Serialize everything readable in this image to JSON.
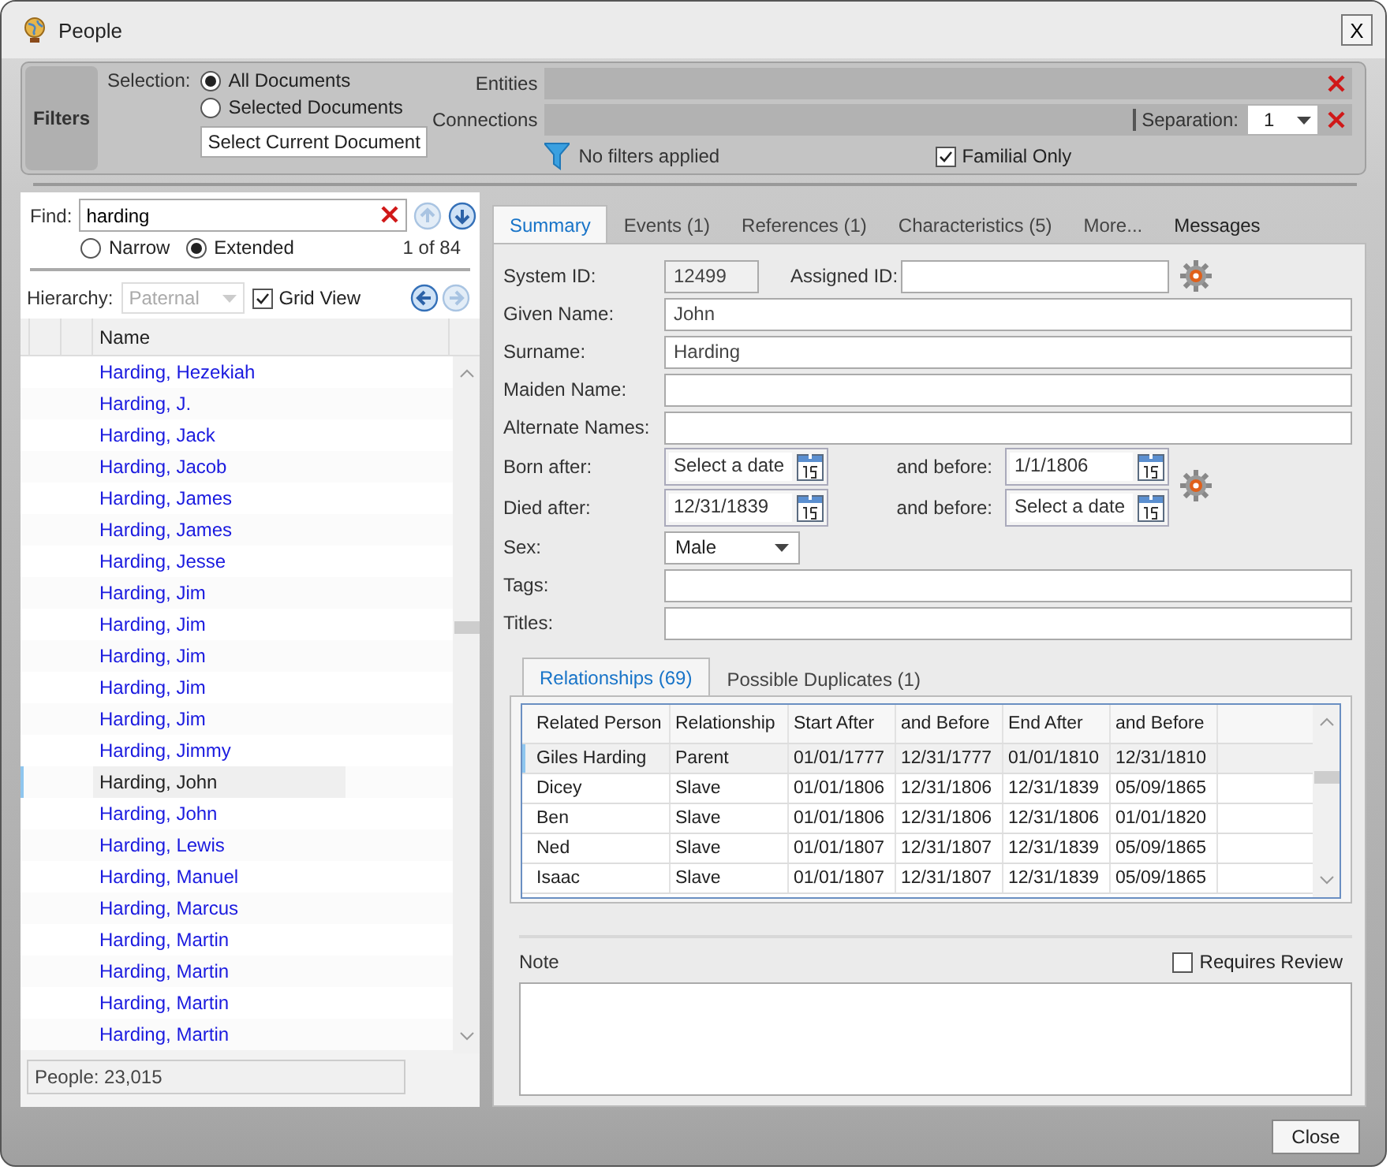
{
  "window": {
    "title": "People",
    "close": "X"
  },
  "filters": {
    "label": "Filters",
    "selection_label": "Selection:",
    "options": [
      {
        "label": "All Documents",
        "selected": true
      },
      {
        "label": "Selected Documents",
        "selected": false
      }
    ],
    "select_current_button": "Select Current Document",
    "entities_label": "Entities",
    "connections_label": "Connections",
    "separation_label": "Separation:",
    "separation_value": "1",
    "status": "No filters applied",
    "familial_only": {
      "label": "Familial Only",
      "checked": true
    }
  },
  "finder": {
    "label": "Find:",
    "value": "harding",
    "modes": [
      {
        "label": "Narrow",
        "selected": false
      },
      {
        "label": "Extended",
        "selected": true
      }
    ],
    "count": "1 of 84",
    "hierarchy_label": "Hierarchy:",
    "hierarchy_value": "Paternal",
    "grid_view": {
      "label": "Grid View",
      "checked": true
    },
    "column": "Name",
    "people": [
      {
        "name": "Harding, Hezekiah",
        "selected": false
      },
      {
        "name": "Harding, J.",
        "selected": false
      },
      {
        "name": "Harding, Jack",
        "selected": false
      },
      {
        "name": "Harding, Jacob",
        "selected": false
      },
      {
        "name": "Harding, James",
        "selected": false
      },
      {
        "name": "Harding, James",
        "selected": false
      },
      {
        "name": "Harding, Jesse",
        "selected": false
      },
      {
        "name": "Harding, Jim",
        "selected": false
      },
      {
        "name": "Harding, Jim",
        "selected": false
      },
      {
        "name": "Harding, Jim",
        "selected": false
      },
      {
        "name": "Harding, Jim",
        "selected": false
      },
      {
        "name": "Harding, Jim",
        "selected": false
      },
      {
        "name": "Harding, Jimmy",
        "selected": false
      },
      {
        "name": "Harding, John",
        "selected": true
      },
      {
        "name": "Harding, John",
        "selected": false
      },
      {
        "name": "Harding, Lewis",
        "selected": false
      },
      {
        "name": "Harding, Manuel",
        "selected": false
      },
      {
        "name": "Harding, Marcus",
        "selected": false
      },
      {
        "name": "Harding, Martin",
        "selected": false
      },
      {
        "name": "Harding, Martin",
        "selected": false
      },
      {
        "name": "Harding, Martin",
        "selected": false
      },
      {
        "name": "Harding, Martin",
        "selected": false
      }
    ],
    "footer": "People: 23,015"
  },
  "tabs": [
    {
      "label": "Summary",
      "selected": true
    },
    {
      "label": "Events (1)",
      "selected": false
    },
    {
      "label": "References (1)",
      "selected": false
    },
    {
      "label": "Characteristics (5)",
      "selected": false
    },
    {
      "label": "More...",
      "selected": false
    },
    {
      "label": "Messages",
      "selected": false
    }
  ],
  "summary": {
    "system_id_label": "System ID:",
    "system_id": "12499",
    "assigned_id_label": "Assigned ID:",
    "fields": [
      {
        "label": "Given Name:",
        "value": "John"
      },
      {
        "label": "Surname:",
        "value": "Harding"
      },
      {
        "label": "Maiden Name:"
      },
      {
        "label": "Alternate Names:"
      }
    ],
    "dates": [
      {
        "label": "Born after:",
        "after": "Select a date",
        "before_label": "and before:",
        "before": "1/1/1806"
      },
      {
        "label": "Died after:",
        "after": "12/31/1839",
        "before_label": "and before:",
        "before": "Select a date"
      }
    ],
    "sex_label": "Sex:",
    "sex": "Male",
    "tags_label": "Tags:",
    "titles_label": "Titles:"
  },
  "sub_tabs": [
    {
      "label": "Relationships (69)",
      "selected": true
    },
    {
      "label": "Possible Duplicates (1)",
      "selected": false
    }
  ],
  "relationships": {
    "columns": [
      "Related Person",
      "Relationship",
      "Start After",
      "and Before",
      "End After",
      "and Before"
    ],
    "rows": [
      {
        "cells": [
          "Giles Harding",
          "Parent",
          "01/01/1777",
          "12/31/1777",
          "01/01/1810",
          "12/31/1810"
        ],
        "selected": true
      },
      {
        "cells": [
          "Dicey",
          "Slave",
          "01/01/1806",
          "12/31/1806",
          "12/31/1839",
          "05/09/1865"
        ],
        "selected": false
      },
      {
        "cells": [
          "Ben",
          "Slave",
          "01/01/1806",
          "12/31/1806",
          "12/31/1806",
          "01/01/1820"
        ],
        "selected": false
      },
      {
        "cells": [
          "Ned",
          "Slave",
          "01/01/1807",
          "12/31/1807",
          "12/31/1839",
          "05/09/1865"
        ],
        "selected": false
      },
      {
        "cells": [
          "Isaac",
          "Slave",
          "01/01/1807",
          "12/31/1807",
          "12/31/1839",
          "05/09/1865"
        ],
        "selected": false
      }
    ]
  },
  "note": {
    "label": "Note",
    "requires_review": {
      "label": "Requires Review",
      "checked": false
    }
  },
  "close_button": "Close"
}
